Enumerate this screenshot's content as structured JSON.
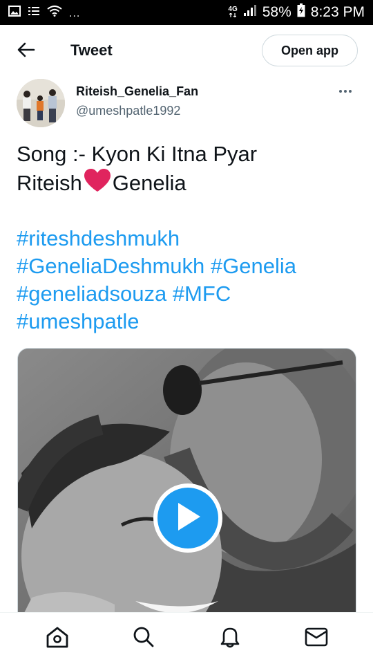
{
  "status_bar": {
    "network": "4G",
    "dots": "...",
    "battery": "58%",
    "time": "8:23 PM"
  },
  "header": {
    "title": "Tweet",
    "open_app_label": "Open app"
  },
  "author": {
    "display_name": "Riteish_Genelia_Fan",
    "handle": "@umeshpatle1992"
  },
  "tweet": {
    "line1": "Song :- Kyon Ki Itna Pyar",
    "line2_before": "Riteish",
    "line2_after": "Genelia",
    "hashtags": {
      "h1": "#riteshdeshmukh",
      "h2": "#GeneliaDeshmukh",
      "h3": "#Genelia",
      "h4": "#geneliadsouza",
      "h5": "#MFC",
      "h6": "#umeshpatle"
    }
  },
  "media": {
    "type": "video"
  },
  "bottom_nav": {
    "items": [
      "home-icon",
      "search-icon",
      "notifications-icon",
      "messages-icon"
    ]
  },
  "colors": {
    "accent": "#1d9bf0",
    "heart": "#e0245e",
    "text": "#0f1419",
    "secondary_text": "#536471"
  }
}
